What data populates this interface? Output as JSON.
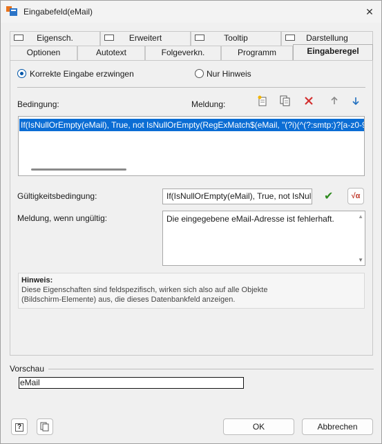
{
  "window": {
    "title": "Eingabefeld(eMail)",
    "close_glyph": "✕"
  },
  "tabs_back": [
    {
      "label": "Eigensch.",
      "has_checkbox": true
    },
    {
      "label": "Erweitert",
      "has_checkbox": true
    },
    {
      "label": "Tooltip",
      "has_checkbox": true
    },
    {
      "label": "Darstellung",
      "has_checkbox": true
    }
  ],
  "tabs_front": [
    {
      "label": "Optionen"
    },
    {
      "label": "Autotext"
    },
    {
      "label": "Folgeverkn."
    },
    {
      "label": "Programm"
    },
    {
      "label": "Eingaberegel",
      "active": true
    }
  ],
  "mode": {
    "option_force": "Korrekte Eingabe erzwingen",
    "option_hint": "Nur Hinweis",
    "selected": "force"
  },
  "rules": {
    "condition_label": "Bedingung:",
    "message_label": "Meldung:",
    "toolbar_icons": [
      "new-rule-icon",
      "copy-icon",
      "delete-icon",
      "arrow-up-icon",
      "arrow-down-icon"
    ],
    "selected_rule": "If(IsNullOrEmpty(eMail), True, not IsNullOrEmpty(RegExMatch$(eMail, \"(?i)(^(?:smtp:)?[a-z0-9!$"
  },
  "validity": {
    "label": "Gültigkeitsbedingung:",
    "value": "If(IsNullOrEmpty(eMail), True, not IsNul",
    "check_glyph": "✔",
    "formula_button_glyph": "√α"
  },
  "invalid_message": {
    "label": "Meldung, wenn ungültig:",
    "value": "Die eingegebene eMail-Adresse ist fehlerhaft."
  },
  "hint": {
    "heading": "Hinweis:",
    "line1": "Diese Eigenschaften sind feldspezifisch, wirken sich also auf alle Objekte",
    "line2": "(Bildschirm-Elemente) aus, die dieses Datenbankfeld anzeigen."
  },
  "preview": {
    "label": "Vorschau",
    "value": "eMail"
  },
  "footer": {
    "help_glyph": "?",
    "ok_label": "OK",
    "cancel_label": "Abbrechen"
  },
  "colors": {
    "selection": "#0b6dd4",
    "check_green": "#2e8b1f",
    "delete_red": "#d32f2f",
    "arrow_blue": "#1f6fbf"
  }
}
